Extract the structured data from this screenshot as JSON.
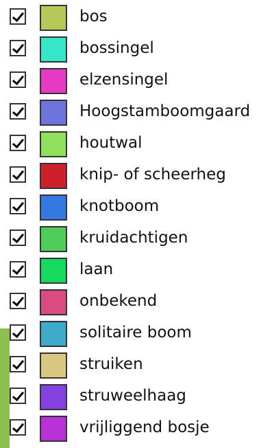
{
  "legend": {
    "items": [
      {
        "label": "bos",
        "checked": true,
        "color": "#b7c85a"
      },
      {
        "label": "bossingel",
        "checked": true,
        "color": "#36e8c8"
      },
      {
        "label": "elzensingel",
        "checked": true,
        "color": "#e43ac4"
      },
      {
        "label": "Hoogstamboomgaard",
        "checked": true,
        "color": "#6f73dc"
      },
      {
        "label": "houtwal",
        "checked": true,
        "color": "#8fe05c"
      },
      {
        "label": "knip- of scheerheg",
        "checked": true,
        "color": "#cc1f28"
      },
      {
        "label": "knotboom",
        "checked": true,
        "color": "#3479df"
      },
      {
        "label": "kruidachtigen",
        "checked": true,
        "color": "#4fcb57"
      },
      {
        "label": "laan",
        "checked": true,
        "color": "#14d85f"
      },
      {
        "label": "onbekend",
        "checked": true,
        "color": "#dc4a83"
      },
      {
        "label": "solitaire boom",
        "checked": true,
        "color": "#3eaac9"
      },
      {
        "label": "struiken",
        "checked": true,
        "color": "#dac781"
      },
      {
        "label": "struweelhaag",
        "checked": true,
        "color": "#8440e0"
      },
      {
        "label": "vrijliggend bosje",
        "checked": true,
        "color": "#ba2fd6"
      }
    ]
  }
}
